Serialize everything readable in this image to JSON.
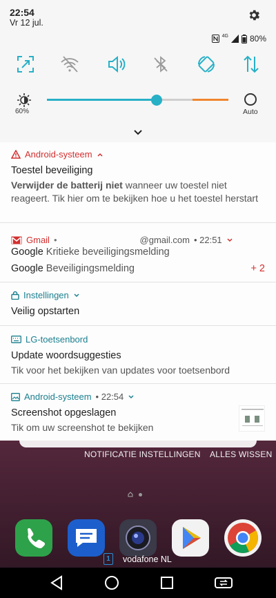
{
  "status_bar": {
    "time": "22:54",
    "date": "Vr 12 jul.",
    "network": "4G",
    "battery": "80%"
  },
  "quick_settings": {
    "tiles": [
      "screenshot-icon",
      "wifi-off-icon",
      "sound-icon",
      "bluetooth-off-icon",
      "auto-rotate-icon",
      "mobile-data-icon"
    ],
    "brightness_pct": "60%",
    "brightness_level": 0.6,
    "auto_label": "Auto",
    "accent": "#27b0c6"
  },
  "notifications": {
    "android1": {
      "app": "Android-systeem",
      "title": "Toestel beveiliging",
      "text_bold": "Verwijder de batterij niet",
      "text_rest": " wanneer uw toestel niet reageert. Tik hier om te bekijken hoe u het toestel herstart",
      "color": "#d32f2f"
    },
    "gmail": {
      "app": "Gmail",
      "sep": "•",
      "email": "@gmail.com",
      "time": "• 22:51",
      "line1_sender": "Google",
      "line1_text": "Kritieke beveiligingsmelding",
      "line2_sender": "Google",
      "line2_text": "Beveiligingsmelding",
      "more": "+ 2",
      "color": "#d32f2f"
    },
    "settings": {
      "app": "Instellingen",
      "title": "Veilig opstarten",
      "color": "#1a7f8e"
    },
    "keyboard": {
      "app": "LG-toetsenbord",
      "title": "Update woordsuggesties",
      "text": "Tik voor het bekijken van updates voor toetsenbord",
      "color": "#1a7f8e"
    },
    "android2": {
      "app": "Android-systeem",
      "time": "• 22:54",
      "title": "Screenshot opgeslagen",
      "text": "Tik om uw screenshot te bekijken",
      "color": "#1a7f8e"
    }
  },
  "footer": {
    "settings_label": "NOTIFICATIE INSTELLINGEN",
    "clear_label": "ALLES WISSEN"
  },
  "home": {
    "dock_apps": [
      "phone-app-icon",
      "messages-app-icon",
      "camera-app-icon",
      "play-store-app-icon",
      "chrome-app-icon"
    ],
    "sim_slot": "1",
    "carrier": "vodafone NL"
  }
}
